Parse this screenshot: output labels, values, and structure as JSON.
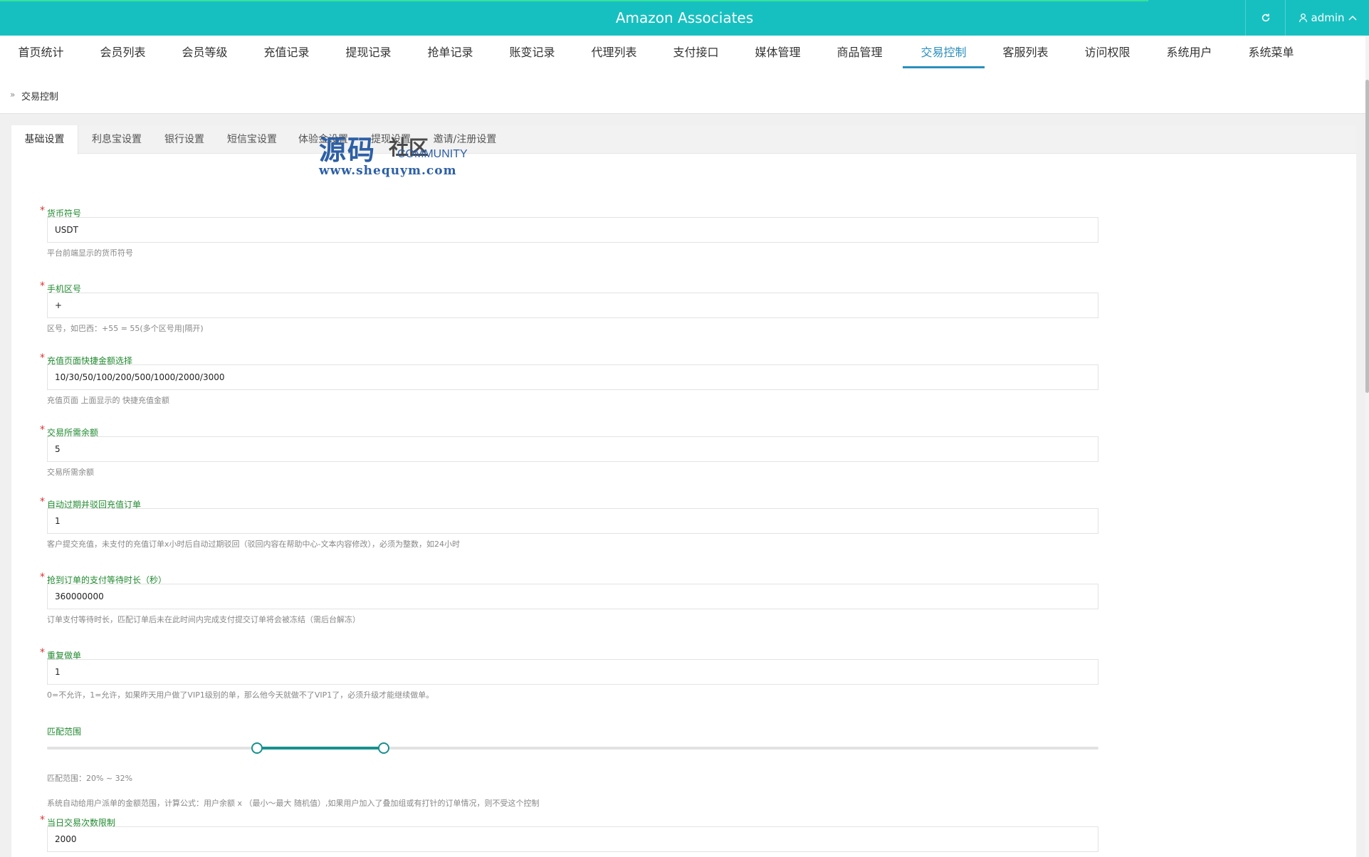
{
  "app": {
    "title": "Amazon Associates",
    "user": "admin"
  },
  "nav": {
    "items": [
      "首页统计",
      "会员列表",
      "会员等级",
      "充值记录",
      "提现记录",
      "抢单记录",
      "账变记录",
      "代理列表",
      "支付接口",
      "媒体管理",
      "商品管理",
      "交易控制",
      "客服列表",
      "访问权限",
      "系统用户",
      "系统菜单"
    ],
    "active": "交易控制"
  },
  "breadcrumb": {
    "current": "交易控制"
  },
  "tabs": {
    "items": [
      "基础设置",
      "利息宝设置",
      "银行设置",
      "短信宝设置",
      "体验金设置",
      "提现设置",
      "邀请/注册设置"
    ],
    "active": "基础设置"
  },
  "watermark": {
    "main": "源码",
    "sub": "社区",
    "community": "COMMUNITY",
    "url": "www.shequym.com"
  },
  "form": {
    "currency": {
      "label": "货币符号",
      "value": "USDT",
      "help": "平台前端显示的货币符号"
    },
    "area_code": {
      "label": "手机区号",
      "value": "+",
      "help": "区号，如巴西：+55 = 55(多个区号用|隔开)"
    },
    "quick_amounts": {
      "label": "充值页面快捷金额选择",
      "value": "10/30/50/100/200/500/1000/2000/3000",
      "help": "充值页面 上面显示的 快捷充值金额"
    },
    "min_balance": {
      "label": "交易所需余额",
      "value": "5",
      "help": "交易所需余额"
    },
    "auto_expire": {
      "label": "自动过期并驳回充值订单",
      "value": "1",
      "help": "客户提交充值，未支付的充值订单x小时后自动过期驳回（驳回内容在帮助中心-文本内容修改），必须为整数，如24小时"
    },
    "pay_wait": {
      "label": "抢到订单的支付等待时长（秒）",
      "value": "360000000",
      "help": "订单支付等待时长，匹配订单后未在此时间内完成支付提交订单将会被冻结（需后台解冻）"
    },
    "repeat_order": {
      "label": "重复做单",
      "value": "1",
      "help": "0=不允许，1=允许，如果昨天用户做了VIP1级别的单，那么他今天就做不了VIP1了，必须升级才能继续做单。"
    },
    "match_range": {
      "label": "匹配范围",
      "min": 20,
      "max": 32,
      "range_text": "匹配范围：20% ~ 32%",
      "help": "系统自动给用户派单的金额范围，计算公式：用户余额 x （最小～最大 随机值）,如果用户加入了叠加组或有打针的订单情况，则不受这个控制"
    },
    "daily_limit": {
      "label": "当日交易次数限制",
      "value": "2000"
    }
  }
}
